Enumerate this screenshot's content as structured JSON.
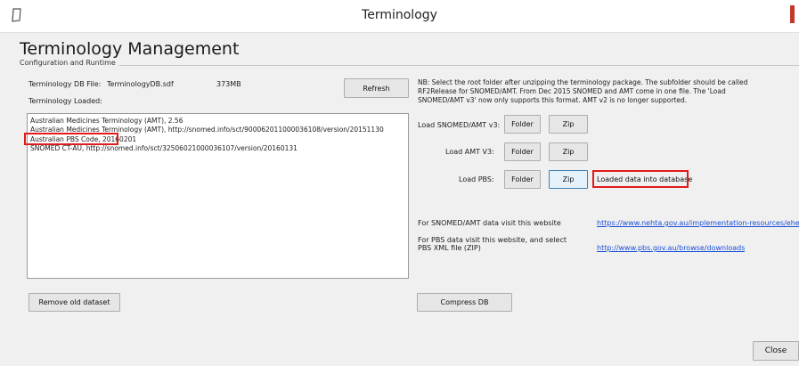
{
  "window": {
    "title": "Terminology",
    "accent_color": "#c0392b"
  },
  "page": {
    "heading": "Terminology Management",
    "group_label": "Configuration and Runtime"
  },
  "db": {
    "file_label": "Terminology DB File:",
    "file_name": "TerminologyDB.sdf",
    "file_size": "373MB",
    "loaded_label": "Terminology Loaded:",
    "refresh_label": "Refresh"
  },
  "loaded_items": [
    "Australian Medicines Terminology (AMT), 2.56",
    "Australian Medicines Terminology (AMT), http://snomed.info/sct/900062011000036108/version/20151130",
    "Australian PBS Code, 20160201",
    "SNOMED CT-AU, http://snomed.info/sct/32506021000036107/version/20160131"
  ],
  "note": {
    "lines": [
      "NB: Select the root folder after unzipping the terminology package.  The subfolder should be called",
      "RF2Release for SNOMED/AMT. From Dec 2015 SNOMED and AMT come in one file. The 'Load",
      "SNOMED/AMT v3' now only supports this format. AMT v2 is no longer supported."
    ]
  },
  "load": {
    "snomed_label": "Load SNOMED/AMT v3:",
    "amt_label": "Load AMT V3:",
    "pbs_label": "Load PBS:",
    "folder_label": "Folder",
    "zip_label": "Zip",
    "status": "Loaded data into database"
  },
  "links": {
    "snomed_text": "For SNOMED/AMT data visit this website",
    "snomed_url": "https://www.nehta.gov.au/implementation-resources/ehealth-f",
    "pbs_text_1": "For PBS data visit this website, and select",
    "pbs_text_2": "PBS XML file (ZIP)",
    "pbs_url": "http://www.pbs.gov.au/browse/downloads"
  },
  "actions": {
    "remove_old": "Remove old dataset",
    "compress": "Compress DB",
    "close": "Close"
  },
  "highlight_color": "#e01b1b"
}
